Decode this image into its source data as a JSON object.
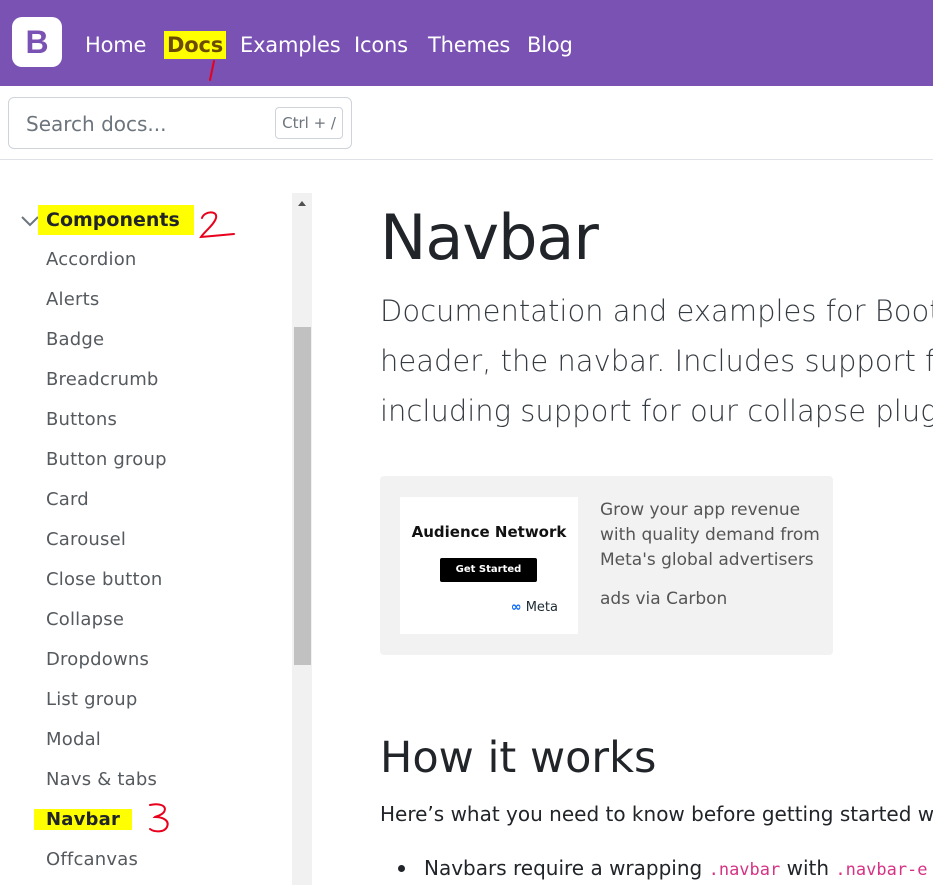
{
  "navbar": {
    "brand_letter": "B",
    "links": [
      {
        "label": "Home"
      },
      {
        "label": "Docs"
      },
      {
        "label": "Examples"
      },
      {
        "label": "Icons"
      },
      {
        "label": "Themes"
      },
      {
        "label": "Blog"
      }
    ],
    "active": "Docs",
    "bg_color": "#7952b3"
  },
  "search": {
    "placeholder": "Search docs...",
    "shortcut": "Ctrl + /"
  },
  "sidebar": {
    "group_label": "Components",
    "items": [
      {
        "label": "Accordion"
      },
      {
        "label": "Alerts"
      },
      {
        "label": "Badge"
      },
      {
        "label": "Breadcrumb"
      },
      {
        "label": "Buttons"
      },
      {
        "label": "Button group"
      },
      {
        "label": "Card"
      },
      {
        "label": "Carousel"
      },
      {
        "label": "Close button"
      },
      {
        "label": "Collapse"
      },
      {
        "label": "Dropdowns"
      },
      {
        "label": "List group"
      },
      {
        "label": "Modal"
      },
      {
        "label": "Navs & tabs"
      },
      {
        "label": "Navbar"
      },
      {
        "label": "Offcanvas"
      }
    ],
    "current": "Navbar"
  },
  "annotations": [
    "1",
    "2",
    "3"
  ],
  "main": {
    "title": "Navbar",
    "lead_lines": [
      "Documentation and examples for Boot",
      "header, the navbar. Includes support fo",
      "including support for our collapse plug"
    ],
    "ad": {
      "image_heading": "Audience Network",
      "image_cta": "Get Started",
      "image_logo": "Meta",
      "text": "Grow your app revenue with quality demand from Meta's global advertisers",
      "via": "ads via Carbon"
    },
    "section_heading": "How it works",
    "section_intro": "Here’s what you need to know before getting started w",
    "bullet": {
      "prefix": "Navbars require a wrapping ",
      "code1": ".navbar",
      "middle": " with ",
      "code2": ".navbar-e"
    }
  },
  "highlight_color": "#ffff00",
  "annotation_color": "#e8001c"
}
